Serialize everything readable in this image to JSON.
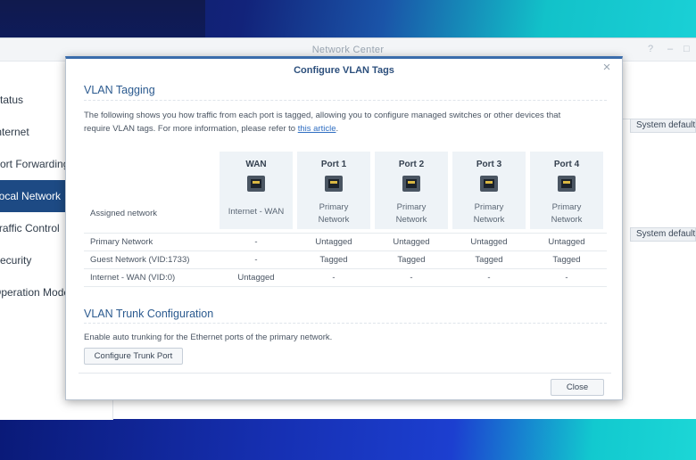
{
  "app": {
    "title": "Network Center"
  },
  "sidebar": {
    "items": [
      {
        "label": "Status"
      },
      {
        "label": "Internet"
      },
      {
        "label": "Port Forwarding"
      },
      {
        "label": "Local Network"
      },
      {
        "label": "Traffic Control"
      },
      {
        "label": "Security"
      },
      {
        "label": "Operation Modes"
      }
    ],
    "active_index": 3
  },
  "background_app": {
    "system_default_1": "System default",
    "system_default_2": "System default"
  },
  "dialog": {
    "title": "Configure VLAN Tags",
    "close_icon": "×",
    "vlan_tagging": {
      "title": "VLAN Tagging",
      "description_line1": "The following shows you how traffic from each port is tagged, allowing you to configure managed switches or other devices that",
      "description_line2_prefix": "require VLAN tags. For more information, please refer to ",
      "description_link": "this article",
      "description_suffix": "."
    },
    "table": {
      "assigned_network_label": "Assigned network",
      "ports": [
        {
          "name": "WAN",
          "network": "Internet - WAN",
          "icon": "ethernet-port-icon"
        },
        {
          "name": "Port 1",
          "network_line1": "Primary",
          "network_line2": "Network",
          "icon": "ethernet-port-icon"
        },
        {
          "name": "Port 2",
          "network_line1": "Primary",
          "network_line2": "Network",
          "icon": "ethernet-port-icon"
        },
        {
          "name": "Port 3",
          "network_line1": "Primary",
          "network_line2": "Network",
          "icon": "ethernet-port-icon"
        },
        {
          "name": "Port 4",
          "network_line1": "Primary",
          "network_line2": "Network",
          "icon": "ethernet-port-icon"
        }
      ],
      "rows": [
        {
          "label": "Primary Network",
          "cells": [
            "-",
            "Untagged",
            "Untagged",
            "Untagged",
            "Untagged"
          ]
        },
        {
          "label": "Guest Network (VID:1733)",
          "cells": [
            "-",
            "Tagged",
            "Tagged",
            "Tagged",
            "Tagged"
          ]
        },
        {
          "label": "Internet - WAN (VID:0)",
          "cells": [
            "Untagged",
            "-",
            "-",
            "-",
            "-"
          ]
        }
      ]
    },
    "trunk": {
      "title": "VLAN Trunk Configuration",
      "description": "Enable auto trunking for the Ethernet ports of the primary network.",
      "button_label": "Configure Trunk Port"
    },
    "close_button_label": "Close"
  },
  "colors": {
    "accent": "#2b5a8f",
    "sidebar_active": "#1d4a84"
  }
}
